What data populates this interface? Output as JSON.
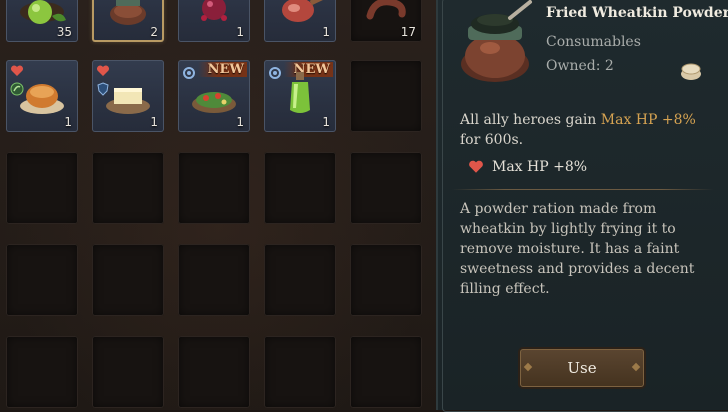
{
  "inventory": {
    "row1": [
      {
        "name": "green-fruit",
        "qty": "35"
      },
      {
        "name": "fried-wheatkin-powder",
        "qty": "2",
        "selected": true
      },
      {
        "name": "berry-flask",
        "qty": "1"
      },
      {
        "name": "meat-roast",
        "qty": "1"
      },
      {
        "name": "sausage",
        "qty": "17"
      }
    ],
    "row2": [
      {
        "name": "pie",
        "qty": "1",
        "badge": "heart"
      },
      {
        "name": "cheese-platter",
        "qty": "1",
        "badge": "heart"
      },
      {
        "name": "salad",
        "qty": "1",
        "badge": "gear",
        "new_label": "NEW"
      },
      {
        "name": "green-potion",
        "qty": "1",
        "badge": "gear",
        "new_label": "NEW"
      }
    ]
  },
  "detail": {
    "title": "Fried Wheatkin Powder",
    "category": "Consumables",
    "owned": "Owned: 2",
    "effect_prefix": "All ally heroes gain ",
    "effect_highlight": "Max HP +8%",
    "effect_suffix": " for 600s.",
    "stat_line": "Max HP +8%",
    "description": "A powder ration made from wheatkin by lightly frying it to remove moisture. It has a faint sweetness and provides a decent filling effect.",
    "use_button": "Use"
  },
  "colors": {
    "highlight": "#d6a352",
    "heart": "#e0564a",
    "slot_filled": "#2a3141",
    "new_badge": "#f1c79b"
  }
}
